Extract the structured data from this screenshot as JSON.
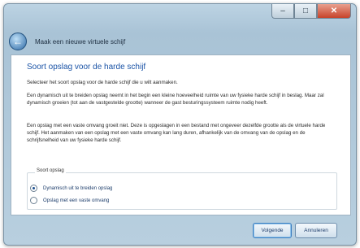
{
  "window": {
    "title": "Maak een nieuwe virtuele schijf",
    "controls": {
      "minimize": "–",
      "maximize": "□",
      "close": "✕"
    }
  },
  "page": {
    "heading": "Soort opslag voor de harde schijf",
    "intro": "Selecteer het soort opslag voor de harde schijf die u wilt aanmaken.",
    "dynamic_paragraph": "Een dynamisch uit te breiden opslag neemt in het begin een kleine hoeveelheid ruimte van uw fysieke harde schijf in beslag. Maar zal dynamisch groeien (tot aan de vastgestelde grootte) wanneer de gast besturingssysteem ruimte nodig heeft.",
    "fixed_paragraph": "Een opslag met een vaste omvang groeit niet. Deze is opgeslagen in een bestand met ongeveer dezelfde grootte als de virtuele harde schijf. Het aanmaken van een opslag met een vaste omvang kan lang duren, afhankelijk van de omvang van de opslag en de schrijfsnelheid van uw fysieke harde schijf.",
    "group_label": "Soort opslag",
    "options": [
      {
        "label": "Dynamisch uit te breiden opslag",
        "selected": true
      },
      {
        "label": "Opslag met een vaste omvang",
        "selected": false
      }
    ]
  },
  "footer": {
    "next_label": "Volgende",
    "cancel_label": "Annuleren"
  },
  "colors": {
    "heading": "#1a53a6",
    "window_frame": "#a9c3d6"
  }
}
